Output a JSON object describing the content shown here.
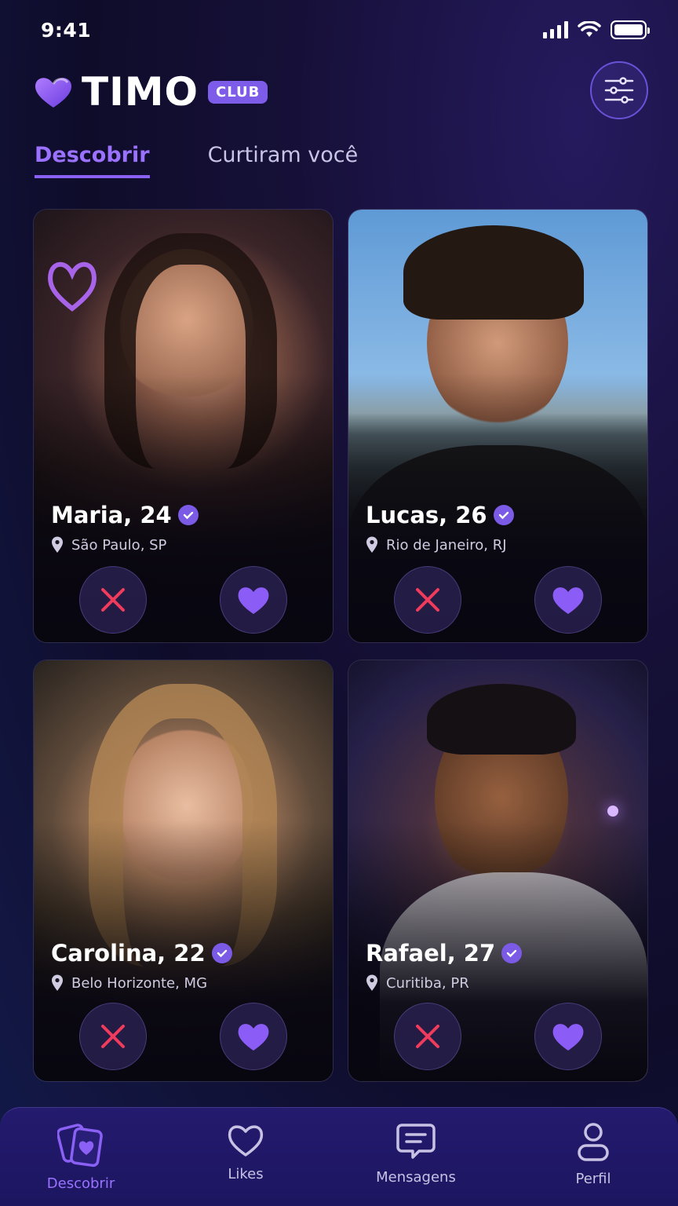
{
  "status_bar": {
    "time": "9:41"
  },
  "header": {
    "logo_text": "TIMO",
    "badge": "CLUB"
  },
  "tabs": [
    {
      "label": "Descobrir",
      "active": true
    },
    {
      "label": "Curtiram você",
      "active": false
    }
  ],
  "profiles": [
    {
      "name": "Maria, 24",
      "location": "São Paulo, SP",
      "verified": true
    },
    {
      "name": "Lucas, 26",
      "location": "Rio de Janeiro, RJ",
      "verified": true
    },
    {
      "name": "Carolina, 22",
      "location": "Belo Horizonte, MG",
      "verified": true
    },
    {
      "name": "Rafael, 27",
      "location": "Curitiba, PR",
      "verified": true
    }
  ],
  "bottom_nav": [
    {
      "label": "Descobrir",
      "icon": "cards-heart-icon",
      "active": true
    },
    {
      "label": "Likes",
      "icon": "heart-outline-icon",
      "active": false
    },
    {
      "label": "Mensagens",
      "icon": "chat-icon",
      "active": false
    },
    {
      "label": "Perfil",
      "icon": "person-icon",
      "active": false
    }
  ],
  "colors": {
    "accent": "#8a60f5",
    "dislike": "#ef3b5c",
    "like": "#8b5cf6"
  }
}
